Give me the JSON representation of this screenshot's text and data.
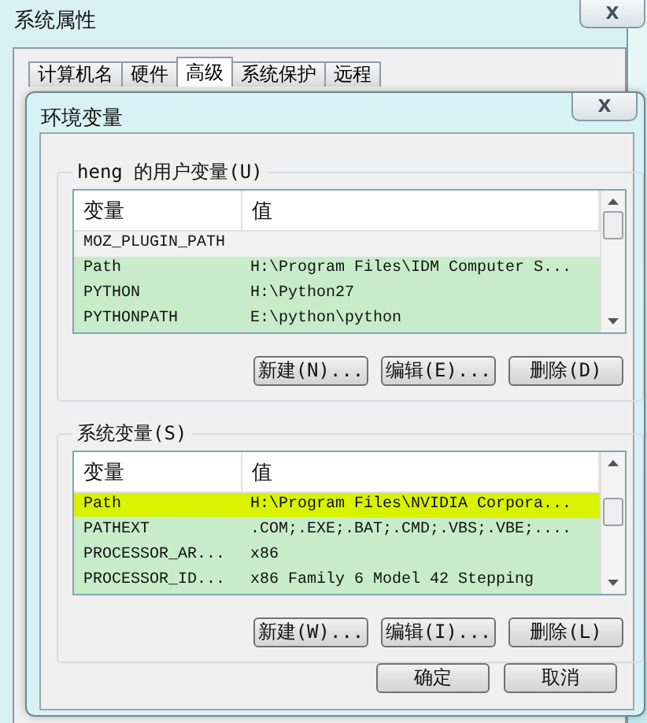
{
  "window": {
    "title": "系统属性",
    "close": "X"
  },
  "tabs": [
    {
      "label": "计算机名",
      "selected": false
    },
    {
      "label": "硬件",
      "selected": false
    },
    {
      "label": "高级",
      "selected": true
    },
    {
      "label": "系统保护",
      "selected": false
    },
    {
      "label": "远程",
      "selected": false
    }
  ],
  "dialog": {
    "title": "环境变量",
    "close": "X",
    "user_vars": {
      "legend": "heng 的用户变量(U)",
      "columns": [
        "变量",
        "值"
      ],
      "rows": [
        {
          "name": "MOZ_PLUGIN_PATH",
          "value": "",
          "selected": false
        },
        {
          "name": "Path",
          "value": "H:\\Program Files\\IDM Computer S...",
          "selected": true
        },
        {
          "name": "PYTHON",
          "value": "H:\\Python27",
          "selected": true
        },
        {
          "name": "PYTHONPATH",
          "value": "E:\\python\\python",
          "selected": true
        }
      ],
      "buttons": [
        "新建(N)...",
        "编辑(E)...",
        "删除(D)"
      ]
    },
    "system_vars": {
      "legend": "系统变量(S)",
      "columns": [
        "变量",
        "值"
      ],
      "rows": [
        {
          "name": "Path",
          "value": "H:\\Program Files\\NVIDIA Corpora...",
          "selected": true,
          "highlighted": true
        },
        {
          "name": "PATHEXT",
          "value": ".COM;.EXE;.BAT;.CMD;.VBS;.VBE;....",
          "selected": true
        },
        {
          "name": "PROCESSOR_AR...",
          "value": "x86",
          "selected": true
        },
        {
          "name": "PROCESSOR_ID...",
          "value": "x86 Family 6 Model 42 Stepping",
          "selected": true
        }
      ],
      "buttons": [
        "新建(W)...",
        "编辑(I)...",
        "删除(L)"
      ]
    },
    "buttons": [
      "确定",
      "取消"
    ]
  }
}
